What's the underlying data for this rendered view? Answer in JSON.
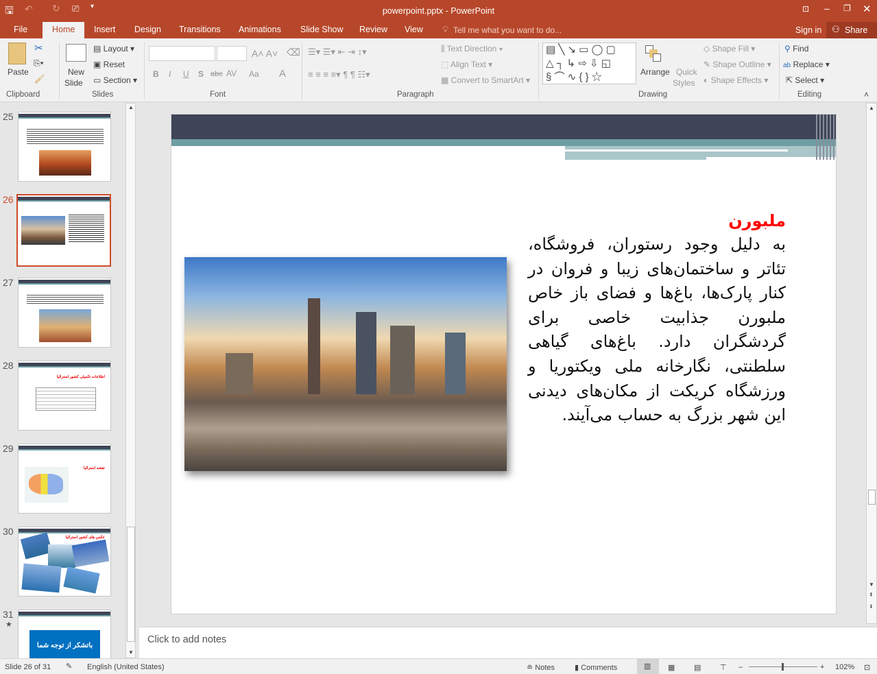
{
  "window": {
    "title": "powerpoint.pptx - PowerPoint"
  },
  "tabs": [
    "File",
    "Home",
    "Insert",
    "Design",
    "Transitions",
    "Animations",
    "Slide Show",
    "Review",
    "View"
  ],
  "tell_me": "Tell me what you want to do...",
  "sign_in": "Sign in",
  "share": "Share",
  "ribbon": {
    "clipboard": {
      "paste": "Paste",
      "group": "Clipboard"
    },
    "slides": {
      "new_slide": "New",
      "new_slide2": "Slide",
      "layout": "Layout",
      "reset": "Reset",
      "section": "Section",
      "group": "Slides"
    },
    "font": {
      "group": "Font",
      "bold": "B",
      "italic": "I",
      "underline": "U",
      "shadow": "S",
      "strike": "abc",
      "spacing": "AV",
      "case": "Aa",
      "color": "A"
    },
    "paragraph": {
      "text_direction": "Text Direction",
      "align_text": "Align Text",
      "smartart": "Convert to SmartArt",
      "group": "Paragraph"
    },
    "drawing": {
      "arrange": "Arrange",
      "quick_styles": "Quick",
      "quick_styles2": "Styles",
      "shape_fill": "Shape Fill",
      "shape_outline": "Shape Outline",
      "shape_effects": "Shape Effects",
      "group": "Drawing"
    },
    "editing": {
      "find": "Find",
      "replace": "Replace",
      "select": "Select",
      "group": "Editing"
    }
  },
  "thumbnails": [
    {
      "num": "25"
    },
    {
      "num": "26",
      "selected": true
    },
    {
      "num": "27"
    },
    {
      "num": "28",
      "title": "اطلاعات تکمیلی کشور استرالیا"
    },
    {
      "num": "29",
      "title": "نقشه استرالیا"
    },
    {
      "num": "30",
      "title": "عکس های کشور استرالیا"
    },
    {
      "num": "31",
      "title": "باتشکر از توجه شما"
    }
  ],
  "slide": {
    "title": "ملبورن",
    "title_color": "#ff0000",
    "body": "به دلیل وجود رستوران، فروشگاه، تئاتر و ساختمان‌های زیبا و فروان در کنار پارک‌ها، باغ‌ها و فضای باز خاص ملبورن جذابیت خاصی برای گردشگران دارد. باغ‌های گیاهی سلطنتی، نگارخانه ملی ویکتوریا و ورزشگاه کریکت از مکان‌های دیدنی این شهر بزرگ به حساب می‌آیند."
  },
  "notes": {
    "placeholder": "Click to add notes"
  },
  "status": {
    "slide": "Slide 26 of 31",
    "language": "English (United States)",
    "notes": "Notes",
    "comments": "Comments",
    "zoom": "102%"
  },
  "colors": {
    "brand": "#b7472a",
    "header_band": "#3f4456",
    "accent_teal": "#6e9ea3"
  }
}
